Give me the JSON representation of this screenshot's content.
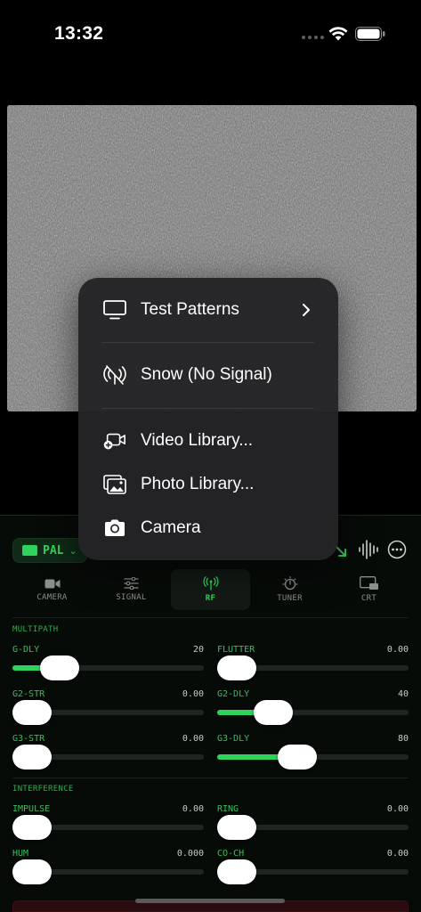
{
  "status_bar": {
    "time": "13:32"
  },
  "menu": {
    "items": [
      {
        "label": "Test Patterns",
        "icon": "monitor-icon",
        "has_submenu": true
      },
      {
        "label": "Snow (No Signal)",
        "icon": "antenna-slash-icon"
      },
      {
        "label": "Video Library...",
        "icon": "video-add-icon"
      },
      {
        "label": "Photo Library...",
        "icon": "photo-library-icon"
      },
      {
        "label": "Camera",
        "icon": "camera-icon"
      }
    ]
  },
  "panel": {
    "mode": "PAL",
    "tabs": [
      {
        "label": "CAMERA",
        "icon": "video-camera-icon",
        "active": false
      },
      {
        "label": "SIGNAL",
        "icon": "sliders-icon",
        "active": false
      },
      {
        "label": "RF",
        "icon": "antenna-icon",
        "active": true
      },
      {
        "label": "TUNER",
        "icon": "dial-icon",
        "active": false
      },
      {
        "label": "CRT",
        "icon": "crt-icon",
        "active": false
      }
    ],
    "sections": [
      {
        "title": "MULTIPATH",
        "sliders": [
          {
            "label": "G-DLY",
            "value": "20",
            "level": 0.18
          },
          {
            "label": "FLUTTER",
            "value": "0.00",
            "level": 0
          },
          {
            "label": "G2-STR",
            "value": "0.00",
            "level": 0
          },
          {
            "label": "G2-DLY",
            "value": "40",
            "level": 0.24
          },
          {
            "label": "G3-STR",
            "value": "0.00",
            "level": 0
          },
          {
            "label": "G3-DLY",
            "value": "80",
            "level": 0.4
          }
        ]
      },
      {
        "title": "INTERFERENCE",
        "sliders": [
          {
            "label": "IMPULSE",
            "value": "0.00",
            "level": 0
          },
          {
            "label": "RING",
            "value": "0.00",
            "level": 0
          },
          {
            "label": "HUM",
            "value": "0.000",
            "level": 0
          },
          {
            "label": "CO-CH",
            "value": "0.00",
            "level": 0
          }
        ]
      }
    ]
  },
  "colors": {
    "accent": "#2fd35a",
    "menu_bg": "#242426",
    "panel_bg": "#070b08"
  }
}
